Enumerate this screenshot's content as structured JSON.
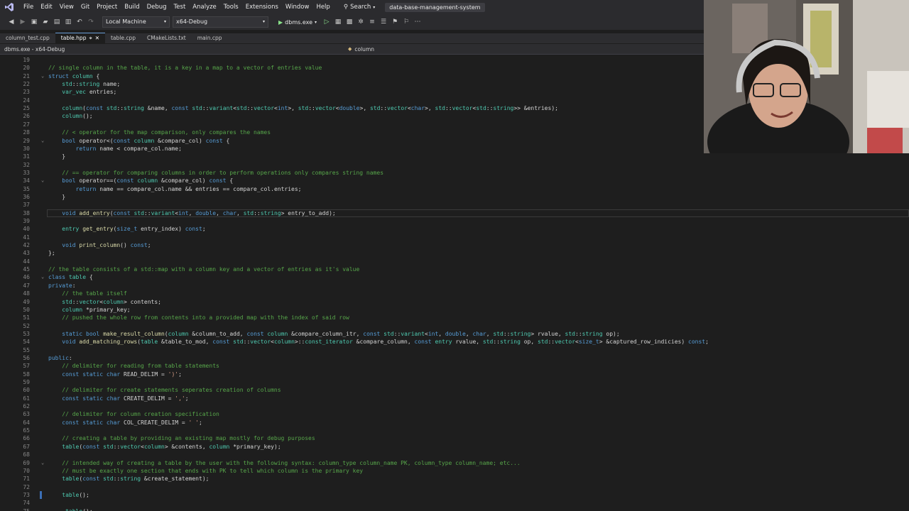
{
  "menu": [
    "File",
    "Edit",
    "View",
    "Git",
    "Project",
    "Build",
    "Debug",
    "Test",
    "Analyze",
    "Tools",
    "Extensions",
    "Window",
    "Help"
  ],
  "search_label": "Search",
  "solution_name": "data-base-management-system",
  "toolbar": {
    "config": "Local Machine",
    "platform": "x64-Debug",
    "run_label": "dbms.exe"
  },
  "tabs": [
    {
      "label": "column_test.cpp",
      "active": false
    },
    {
      "label": "table.hpp",
      "active": true
    },
    {
      "label": "table.cpp",
      "active": false
    },
    {
      "label": "CMakeLists.txt",
      "active": false
    },
    {
      "label": "main.cpp",
      "active": false
    }
  ],
  "nav": {
    "left": "dbms.exe - x64-Debug",
    "right": "column"
  },
  "colors": {
    "keyword": "#569cd6",
    "type": "#4ec9b0",
    "comment": "#57a64a",
    "function": "#dcdcaa",
    "string": "#d69d85",
    "text": "#d4d4d4",
    "param": "#9cdcfe"
  },
  "current_line": 38,
  "lines": [
    {
      "n": "19",
      "t": ""
    },
    {
      "n": "20",
      "t": "// single column in the table, it is a key in a map to a vector of entries value"
    },
    {
      "n": "21",
      "t": "struct column {"
    },
    {
      "n": "22",
      "t": "    std::string name;"
    },
    {
      "n": "23",
      "t": "    var_vec entries;"
    },
    {
      "n": "24",
      "t": ""
    },
    {
      "n": "25",
      "t": "    column(const std::string &name, const std::variant<std::vector<int>, std::vector<double>, std::vector<char>, std::vector<std::string>> &entries);"
    },
    {
      "n": "26",
      "t": "    column();"
    },
    {
      "n": "27",
      "t": ""
    },
    {
      "n": "28",
      "t": "    // < operator for the map comparison, only compares the names"
    },
    {
      "n": "29",
      "t": "    bool operator<(const column &compare_col) const {"
    },
    {
      "n": "30",
      "t": "        return name < compare_col.name;"
    },
    {
      "n": "31",
      "t": "    }"
    },
    {
      "n": "32",
      "t": ""
    },
    {
      "n": "33",
      "t": "    // == operator for comparing columns in order to perform operations only compares string names"
    },
    {
      "n": "34",
      "t": "    bool operator==(const column &compare_col) const {"
    },
    {
      "n": "35",
      "t": "        return name == compare_col.name && entries == compare_col.entries;"
    },
    {
      "n": "36",
      "t": "    }"
    },
    {
      "n": "37",
      "t": ""
    },
    {
      "n": "38",
      "t": "    void add_entry(const std::variant<int, double, char, std::string> entry_to_add);"
    },
    {
      "n": "39",
      "t": ""
    },
    {
      "n": "40",
      "t": "    entry get_entry(size_t entry_index) const;"
    },
    {
      "n": "41",
      "t": ""
    },
    {
      "n": "42",
      "t": "    void print_column() const;"
    },
    {
      "n": "43",
      "t": "};"
    },
    {
      "n": "44",
      "t": ""
    },
    {
      "n": "45",
      "t": "// the table consists of a std::map with a column key and a vector of entries as it's value"
    },
    {
      "n": "46",
      "t": "class table {"
    },
    {
      "n": "47",
      "t": "private:"
    },
    {
      "n": "48",
      "t": "    // the table itself"
    },
    {
      "n": "49",
      "t": "    std::vector<column> contents;"
    },
    {
      "n": "50",
      "t": "    column *primary_key;"
    },
    {
      "n": "51",
      "t": "    // pushed the whole row from contents into a provided map with the index of said row"
    },
    {
      "n": "52",
      "t": ""
    },
    {
      "n": "53",
      "t": "    static bool make_result_column(column &column_to_add, const column &compare_column_itr, const std::variant<int, double, char, std::string> rvalue, std::string op);"
    },
    {
      "n": "54",
      "t": "    void add_matching_rows(table &table_to_mod, const std::vector<column>::const_iterator &compare_column, const entry rvalue, std::string op, std::vector<size_t> &captured_row_indicies) const;"
    },
    {
      "n": "55",
      "t": ""
    },
    {
      "n": "56",
      "t": "public:"
    },
    {
      "n": "57",
      "t": "    // delimiter for reading from table statements"
    },
    {
      "n": "58",
      "t": "    const static char READ_DELIM = ')';"
    },
    {
      "n": "59",
      "t": ""
    },
    {
      "n": "60",
      "t": "    // delimiter for create statements seperates creation of columns"
    },
    {
      "n": "61",
      "t": "    const static char CREATE_DELIM = ',';"
    },
    {
      "n": "62",
      "t": ""
    },
    {
      "n": "63",
      "t": "    // delimiter for column creation specification"
    },
    {
      "n": "64",
      "t": "    const static char COL_CREATE_DELIM = ' ';"
    },
    {
      "n": "65",
      "t": ""
    },
    {
      "n": "66",
      "t": "    // creating a table by providing an existing map mostly for debug purposes"
    },
    {
      "n": "67",
      "t": "    table(const std::vector<column> &contents, column *primary_key);"
    },
    {
      "n": "68",
      "t": ""
    },
    {
      "n": "69",
      "t": "    // intended way of creating a table by the user with the following syntax: column_type column_name PK, column_type column_name; etc..."
    },
    {
      "n": "70",
      "t": "    // must be exactly one section that ends with PK to tell which column is the primary key"
    },
    {
      "n": "71",
      "t": "    table(const std::string &create_statement);"
    },
    {
      "n": "72",
      "t": ""
    },
    {
      "n": "73",
      "t": "    table();"
    },
    {
      "n": "74",
      "t": ""
    },
    {
      "n": "75",
      "t": "    ~table();"
    }
  ]
}
